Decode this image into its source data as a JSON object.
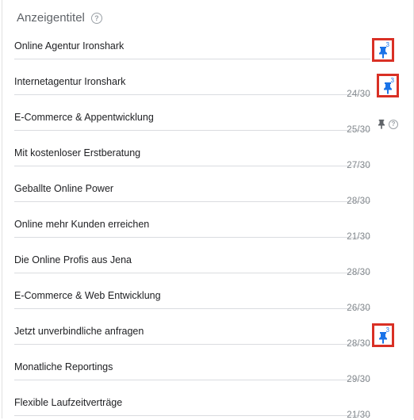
{
  "header": {
    "title": "Anzeigentitel",
    "help_icon": "?"
  },
  "rows": [
    {
      "text": "Online Agentur Ironshark",
      "count": ""
    },
    {
      "text": "Internetagentur Ironshark",
      "count": "24/30"
    },
    {
      "text": "E-Commerce & Appentwicklung",
      "count": "25/30"
    },
    {
      "text": "Mit kostenloser Erstberatung",
      "count": "27/30"
    },
    {
      "text": "Geballte Online Power",
      "count": "28/30"
    },
    {
      "text": "Online mehr Kunden erreichen",
      "count": "21/30"
    },
    {
      "text": "Die Online Profis aus Jena",
      "count": "28/30"
    },
    {
      "text": "E-Commerce & Web Entwicklung",
      "count": "26/30"
    },
    {
      "text": "Jetzt unverbindliche anfragen",
      "count": "28/30"
    },
    {
      "text": "Monatliche Reportings",
      "count": "29/30"
    },
    {
      "text": "Flexible Laufzeitverträge",
      "count": "21/30"
    }
  ],
  "pins": [
    {
      "row": 0,
      "position": "3",
      "icon": "pin-icon",
      "color": "#1a73e8"
    },
    {
      "row": 1,
      "position": "3",
      "icon": "pin-icon",
      "color": "#1a73e8"
    },
    {
      "row": 8,
      "position": "3",
      "icon": "pin-icon",
      "color": "#1a73e8"
    }
  ],
  "unpinned": {
    "icon": "pin-icon",
    "color": "#5f6368",
    "help_icon": "?"
  },
  "colors": {
    "highlight": "#d93025",
    "divider": "#dadce0",
    "muted": "#80868b"
  }
}
